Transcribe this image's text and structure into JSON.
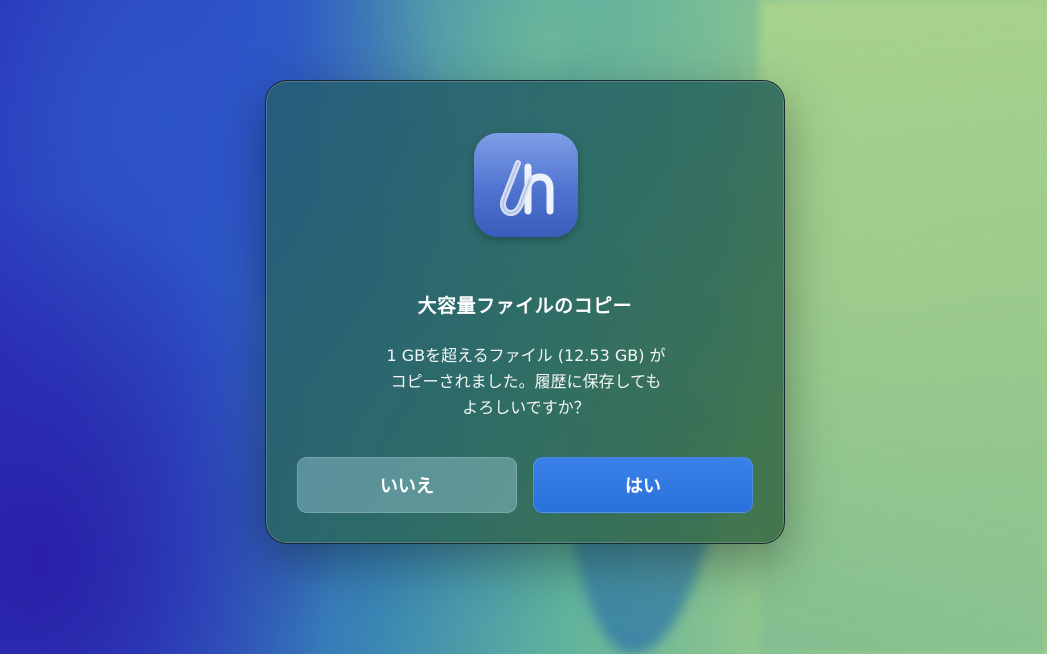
{
  "dialog": {
    "app_icon": "hop-link-app-icon",
    "title": "大容量ファイルのコピー",
    "message_lines": [
      "1 GBを超えるファイル (12.53 GB) が",
      "コピーされました。履歴に保存しても",
      "よろしいですか？"
    ],
    "buttons": {
      "no_label": "いいえ",
      "yes_label": "はい"
    }
  },
  "colors": {
    "primary_button": "#2a70dc",
    "secondary_button": "#8fbfc8",
    "text": "#ffffff"
  }
}
